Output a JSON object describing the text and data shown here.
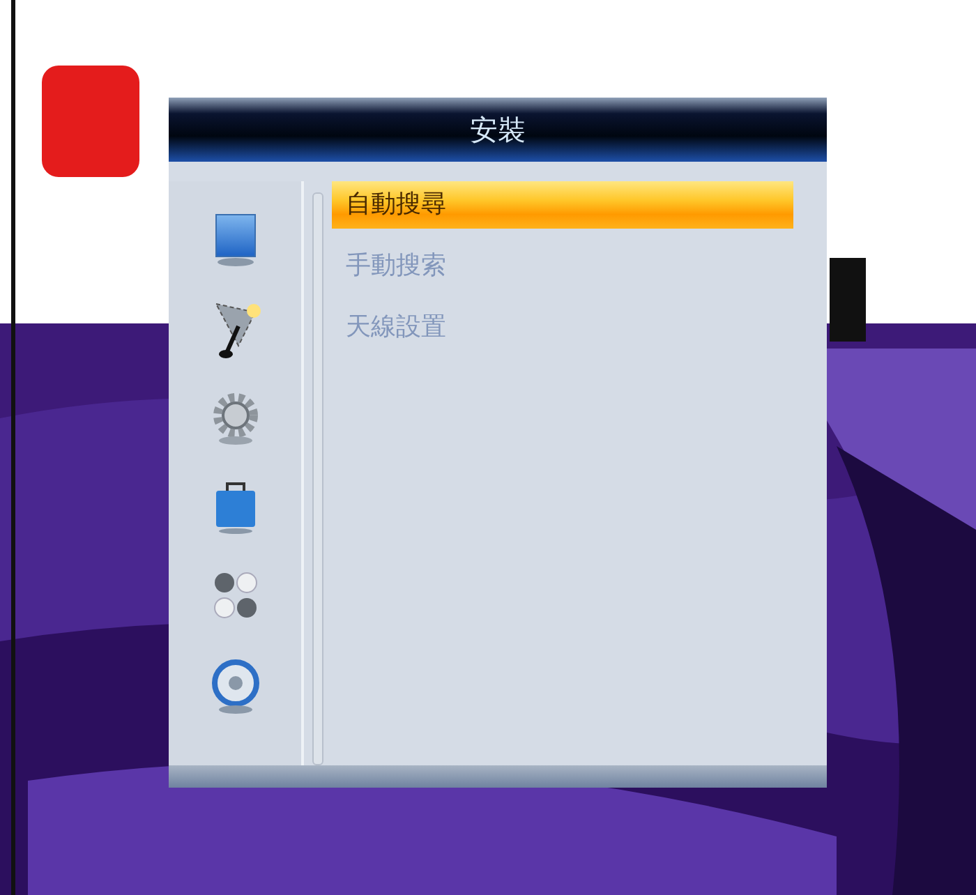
{
  "window": {
    "title": "安裝"
  },
  "sidebar": {
    "items": [
      {
        "kind": "monitor"
      },
      {
        "kind": "dish"
      },
      {
        "kind": "gear"
      },
      {
        "kind": "bag"
      },
      {
        "kind": "dots"
      },
      {
        "kind": "disc"
      }
    ]
  },
  "menu": {
    "items": [
      {
        "label": "自動搜尋",
        "selected": true
      },
      {
        "label": "手動搜索",
        "selected": false
      },
      {
        "label": "天線設置",
        "selected": false
      }
    ]
  }
}
